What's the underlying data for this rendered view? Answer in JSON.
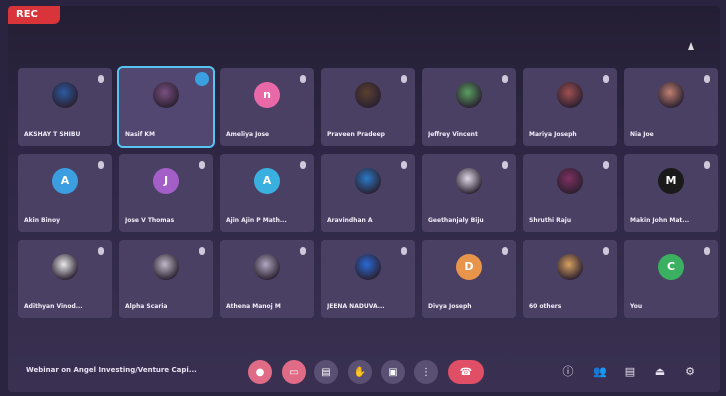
{
  "participants": [
    {
      "name": "AKSHAY T SHIBU",
      "avatar_letter": "",
      "avatar_color": "#2c5aa0",
      "photo": true
    },
    {
      "name": "Nasif KM",
      "avatar_letter": "",
      "avatar_color": "#7a5080",
      "photo": true,
      "active": true
    },
    {
      "name": "Ameliya Jose",
      "avatar_letter": "n",
      "avatar_color": "#e868a8",
      "photo": false
    },
    {
      "name": "Praveen Pradeep",
      "avatar_letter": "",
      "avatar_color": "#5a4030",
      "photo": true
    },
    {
      "name": "Jeffrey Vincent",
      "avatar_letter": "",
      "avatar_color": "#5aa060",
      "photo": true
    },
    {
      "name": "Mariya Joseph",
      "avatar_letter": "",
      "avatar_color": "#a05050",
      "photo": true
    },
    {
      "name": "Nia Joe",
      "avatar_letter": "",
      "avatar_color": "#c08070",
      "photo": true
    },
    {
      "name": "Akin Binoy",
      "avatar_letter": "A",
      "avatar_color": "#3a9ee0",
      "photo": false
    },
    {
      "name": "Jose V Thomas",
      "avatar_letter": "J",
      "avatar_color": "#a45ec8",
      "photo": false
    },
    {
      "name": "Ajin Ajin P Math...",
      "avatar_letter": "A",
      "avatar_color": "#3ab0e0",
      "photo": false
    },
    {
      "name": "Aravindhan A",
      "avatar_letter": "",
      "avatar_color": "#2a7ac8",
      "photo": true
    },
    {
      "name": "Geethanjaly Biju",
      "avatar_letter": "",
      "avatar_color": "#e0d8e8",
      "photo": true
    },
    {
      "name": "Shruthi Raju",
      "avatar_letter": "",
      "avatar_color": "#803060",
      "photo": true
    },
    {
      "name": "Makin John Mat...",
      "avatar_letter": "M",
      "avatar_color": "#1a1a1a",
      "photo": false
    },
    {
      "name": "Adithyan Vinod...",
      "avatar_letter": "",
      "avatar_color": "#e8e8e8",
      "photo": true
    },
    {
      "name": "Alpha Scaria",
      "avatar_letter": "",
      "avatar_color": "#c0b8c8",
      "photo": true
    },
    {
      "name": "Athena Manoj M",
      "avatar_letter": "",
      "avatar_color": "#b0a8c0",
      "photo": true
    },
    {
      "name": "JEENA NADUVA...",
      "avatar_letter": "",
      "avatar_color": "#2a6ad8",
      "photo": true
    },
    {
      "name": "Divya Joseph",
      "avatar_letter": "D",
      "avatar_color": "#e8944a",
      "photo": false
    },
    {
      "name": "60 others",
      "avatar_letter": "",
      "avatar_color": "#d8a060",
      "photo": true
    },
    {
      "name": "You",
      "avatar_letter": "C",
      "avatar_color": "#3ab060",
      "photo": false
    }
  ],
  "meeting": {
    "title": "Webinar on Angel Investing/Venture Capi..."
  },
  "recording_badge": "REC",
  "controls": [
    "mic",
    "camera",
    "captions",
    "hand",
    "present",
    "more",
    "end-call"
  ],
  "right_icons": [
    "info",
    "people",
    "chat",
    "activities",
    "host-controls"
  ]
}
